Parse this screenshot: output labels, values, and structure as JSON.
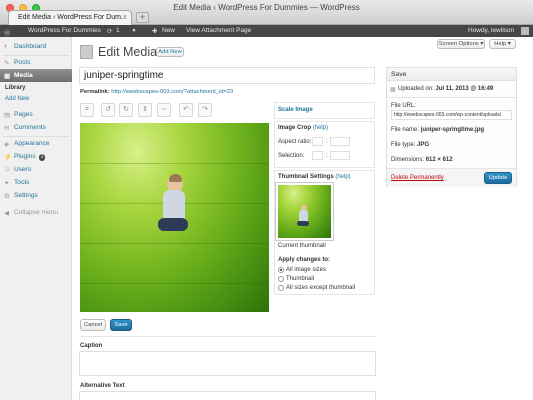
{
  "window": {
    "title": "Edit Media ‹ WordPress For Dummies — WordPress",
    "tab_label": "Edit Media ‹ WordPress For Dum...",
    "tab_close": "×",
    "new_tab": "+"
  },
  "admin_bar": {
    "site": "WordPress For Dummies",
    "updates_count": "1",
    "new_label": "New",
    "view_label": "View Attachment Page",
    "howdy": "Howdy, lewilson"
  },
  "sidebar": {
    "dashboard": "Dashboard",
    "posts": "Posts",
    "media": "Media",
    "library": "Library",
    "add_new": "Add New",
    "pages": "Pages",
    "comments": "Comments",
    "appearance": "Appearance",
    "plugins": "Plugins",
    "plugins_badge": "1",
    "users": "Users",
    "tools": "Tools",
    "settings": "Settings",
    "collapse": "Collapse menu"
  },
  "screen_options": "Screen Options ▾",
  "help": "Help ▾",
  "page": {
    "title": "Edit Media",
    "add_new": "Add New",
    "media_title": "juniper-springtime",
    "permalink_label": "Permalink:",
    "permalink_url": "http://ewebscapes-003.com/?attachment_id=23"
  },
  "editor": {
    "scale_image": "Scale Image",
    "image_crop": "Image Crop",
    "help": "(help)",
    "aspect_ratio": "Aspect ratio:",
    "aspect_sep": ":",
    "selection": "Selection:",
    "selection_sep": ":",
    "thumbnail_settings": "Thumbnail Settings",
    "current_thumbnail": "Current thumbnail",
    "apply_changes": "Apply changes to:",
    "options": [
      "All image sizes",
      "Thumbnail",
      "All sizes except thumbnail"
    ],
    "selected_option": 0,
    "cancel": "Cancel",
    "save": "Save"
  },
  "fields": {
    "caption": "Caption",
    "alt_text": "Alternative Text"
  },
  "save_box": {
    "title": "Save",
    "uploaded_label": "Uploaded on:",
    "uploaded_value": "Jul 11, 2013 @ 16:49",
    "file_url_label": "File URL:",
    "file_url": "http://ewebscapes-003.com/wp-content/uploads/",
    "file_name_label": "File name:",
    "file_name": "juniper-springtime.jpg",
    "file_type_label": "File type:",
    "file_type": "JPG",
    "dimensions_label": "Dimensions:",
    "dimensions": "612 × 612",
    "delete": "Delete Permanently",
    "update": "Update"
  },
  "colors": {
    "link": "#21759b",
    "primary_button": "#21759b",
    "admin_bar": "#464646",
    "delete": "#bc0b0b"
  }
}
